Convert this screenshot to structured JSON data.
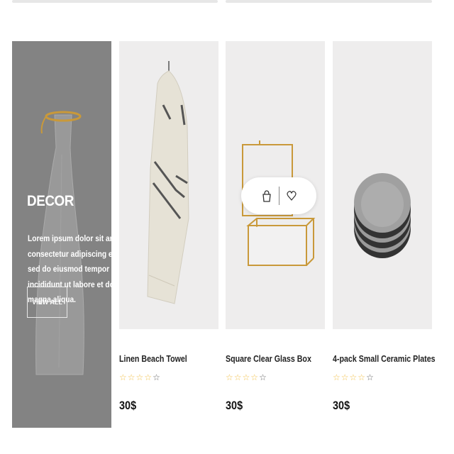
{
  "promo": {
    "title": "DECOR",
    "text_lines": [
      "Lorem ipsum dolor sit amet,",
      "consectetur adipiscing elit,",
      "sed do eiusmod tempor",
      "incididunt ut labore et dolore",
      "magna aliqua."
    ],
    "button_label": "VIEW ALL"
  },
  "products": [
    {
      "name": "Linen Beach Towel",
      "rating": 4,
      "rating_max": 5,
      "price": "30$"
    },
    {
      "name": "Square Clear Glass Box",
      "rating": 4,
      "rating_max": 5,
      "price": "30$"
    },
    {
      "name": "4-pack Small Ceramic Plates",
      "rating": 4,
      "rating_max": 5,
      "price": "30$"
    }
  ],
  "hover_actions": {
    "icons": [
      "bag-icon",
      "heart-icon"
    ]
  },
  "colors": {
    "star": "#f1c14b",
    "promo_bg": "#838383",
    "card_bg": "#eeeded",
    "gold": "#c9993a"
  }
}
